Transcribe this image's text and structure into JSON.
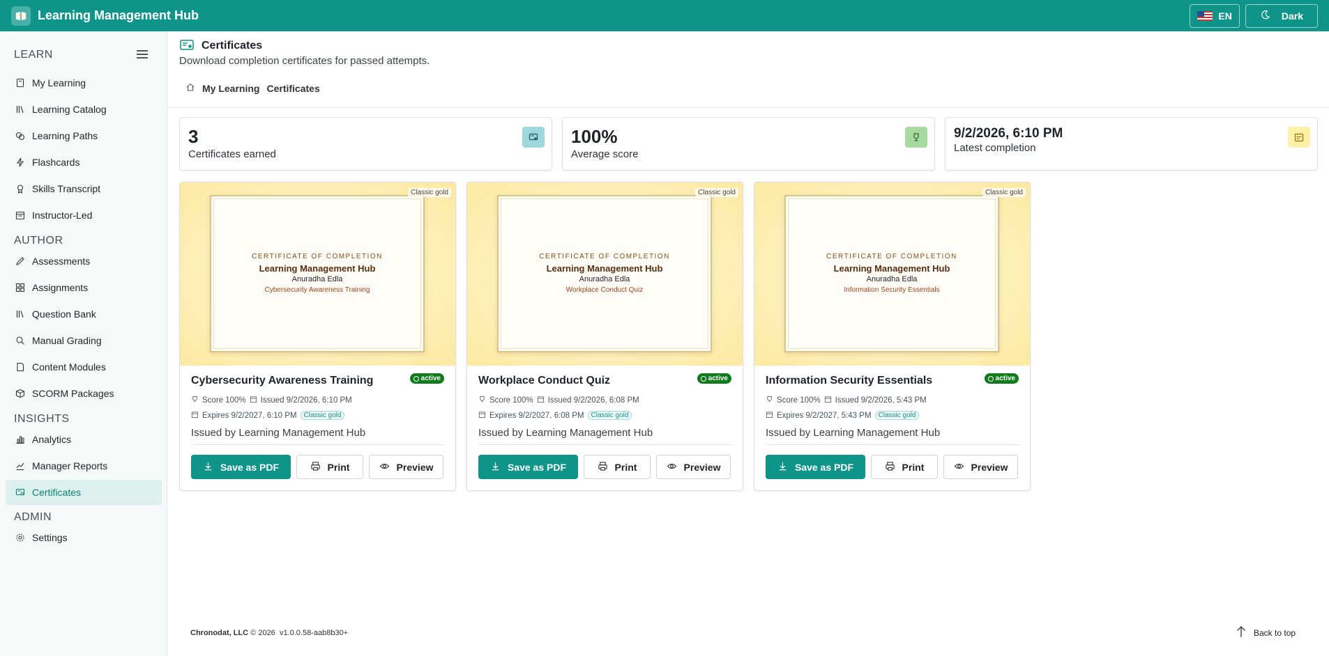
{
  "app": {
    "title": "Learning Management Hub",
    "language": "EN",
    "theme_label": "Dark"
  },
  "sidebar": {
    "sections": [
      {
        "title": "LEARN",
        "items": [
          {
            "label": "My Learning",
            "icon": "book-icon"
          },
          {
            "label": "Learning Catalog",
            "icon": "library-icon"
          },
          {
            "label": "Learning Paths",
            "icon": "paths-icon"
          },
          {
            "label": "Flashcards",
            "icon": "bolt-icon"
          },
          {
            "label": "Skills Transcript",
            "icon": "badge-icon"
          },
          {
            "label": "Instructor-Led",
            "icon": "calendar-icon"
          }
        ]
      },
      {
        "title": "AUTHOR",
        "items": [
          {
            "label": "Assessments",
            "icon": "pencil-icon"
          },
          {
            "label": "Assignments",
            "icon": "grid-icon"
          },
          {
            "label": "Question Bank",
            "icon": "library-icon"
          },
          {
            "label": "Manual Grading",
            "icon": "grading-icon"
          },
          {
            "label": "Content Modules",
            "icon": "document-icon"
          },
          {
            "label": "SCORM Packages",
            "icon": "package-icon"
          }
        ]
      },
      {
        "title": "INSIGHTS",
        "items": [
          {
            "label": "Analytics",
            "icon": "chart-icon"
          },
          {
            "label": "Manager Reports",
            "icon": "report-icon"
          },
          {
            "label": "Certificates",
            "icon": "certificate-icon",
            "active": true
          }
        ]
      },
      {
        "title": "ADMIN",
        "items": [
          {
            "label": "Settings",
            "icon": "gear-icon"
          }
        ]
      }
    ]
  },
  "header": {
    "title": "Certificates",
    "subtitle": "Download completion certificates for passed attempts.",
    "breadcrumb": [
      "My Learning",
      "Certificates"
    ]
  },
  "stats": [
    {
      "value": "3",
      "label": "Certificates earned",
      "icon": "certificate-icon",
      "color": "#9fd8dc"
    },
    {
      "value": "100%",
      "label": "Average score",
      "icon": "trophy-icon",
      "color": "#a8d9a0"
    },
    {
      "value": "9/2/2026, 6:10 PM",
      "label": "Latest completion",
      "icon": "calendar-icon",
      "color": "#fdf1a8"
    }
  ],
  "certificates": [
    {
      "template": "Classic gold",
      "heading": "CERTIFICATE OF COMPLETION",
      "org": "Learning Management Hub",
      "recipient": "Anuradha Edla",
      "course": "Cybersecurity Awareness Training",
      "title": "Cybersecurity Awareness Training",
      "status": "active",
      "score": "Score 100%",
      "issued": "Issued 9/2/2026, 6:10 PM",
      "expires": "Expires 9/2/2027, 6:10 PM",
      "issuer": "Issued by Learning Management Hub"
    },
    {
      "template": "Classic gold",
      "heading": "CERTIFICATE OF COMPLETION",
      "org": "Learning Management Hub",
      "recipient": "Anuradha Edla",
      "course": "Workplace Conduct Quiz",
      "title": "Workplace Conduct Quiz",
      "status": "active",
      "score": "Score 100%",
      "issued": "Issued 9/2/2026, 6:08 PM",
      "expires": "Expires 9/2/2027, 6:08 PM",
      "issuer": "Issued by Learning Management Hub"
    },
    {
      "template": "Classic gold",
      "heading": "CERTIFICATE OF COMPLETION",
      "org": "Learning Management Hub",
      "recipient": "Anuradha Edla",
      "course": "Information Security Essentials",
      "title": "Information Security Essentials",
      "status": "active",
      "score": "Score 100%",
      "issued": "Issued 9/2/2026, 5:43 PM",
      "expires": "Expires 9/2/2027, 5:43 PM",
      "issuer": "Issued by Learning Management Hub"
    }
  ],
  "actions": {
    "save_pdf": "Save as PDF",
    "print": "Print",
    "preview": "Preview"
  },
  "footer": {
    "company": "Chronodat, LLC",
    "copyright": "© 2026",
    "version": "v1.0.0.58-aab8b30+",
    "back_to_top": "Back to top"
  },
  "colors": {
    "primary": "#0e9488",
    "active_badge": "#0f7b1a"
  }
}
